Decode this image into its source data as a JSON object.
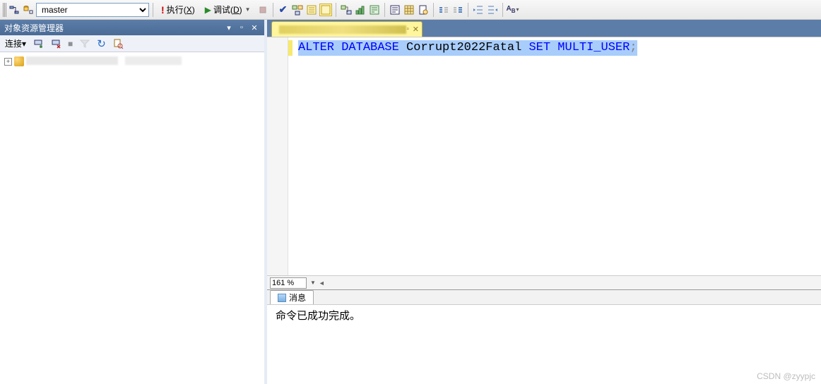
{
  "toolbar": {
    "db_selected": "master",
    "execute_label": "执行",
    "execute_key": "X",
    "debug_label": "调试",
    "debug_key": "D"
  },
  "panel": {
    "title": "对象资源管理器",
    "connect_label": "连接"
  },
  "zoom": {
    "value": "161 %"
  },
  "messages": {
    "tab_label": "消息",
    "body": "命令已成功完成。"
  },
  "sql": {
    "segments": [
      {
        "t": "ALTER",
        "c": "kw"
      },
      {
        "t": " ",
        "c": ""
      },
      {
        "t": "DATABASE",
        "c": "kw"
      },
      {
        "t": " ",
        "c": ""
      },
      {
        "t": "Corrupt2022Fatal",
        "c": "ident"
      },
      {
        "t": " ",
        "c": ""
      },
      {
        "t": "SET",
        "c": "kw"
      },
      {
        "t": " ",
        "c": ""
      },
      {
        "t": "MULTI_USER",
        "c": "kw"
      },
      {
        "t": ";",
        "c": "punct"
      }
    ]
  },
  "watermark": "CSDN @zyypjc"
}
